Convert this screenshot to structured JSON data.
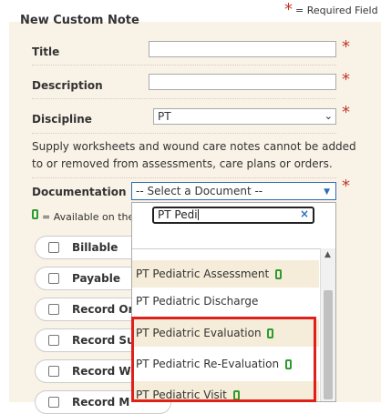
{
  "header": {
    "title": "New Custom Note",
    "required_star": "*",
    "required_label": "= Required Field"
  },
  "form": {
    "title_label": "Title",
    "title_value": "",
    "description_label": "Description",
    "description_value": "",
    "discipline_label": "Discipline",
    "discipline_value": "PT",
    "note": "Supply worksheets and wound care notes cannot be added to or removed from assessments, care plans or orders.",
    "note_line1": "Supply worksheets and wound care notes cannot be added",
    "note_line2": "to or removed from assessments, care plans or orders.",
    "documentation_label": "Documentation",
    "documentation_value": "-- Select a Document --",
    "available_legend": "= Available on the",
    "required_star": "*"
  },
  "checkboxes": [
    {
      "label": "Billable",
      "checked": false
    },
    {
      "label": "Payable",
      "checked": false
    },
    {
      "label": "Record Ord",
      "checked": false
    },
    {
      "label": "Record Sup",
      "checked": false
    },
    {
      "label": "Record Wo",
      "checked": false
    },
    {
      "label": "Record M",
      "checked": false
    }
  ],
  "dropdown": {
    "search_value": "PT Pedi",
    "clear_icon": "×",
    "options": [
      {
        "label": "PT Pediatric Assessment",
        "mobile": true,
        "highlighted": true
      },
      {
        "label": "PT Pediatric Discharge",
        "mobile": false,
        "highlighted": false
      },
      {
        "label": "PT Pediatric Evaluation",
        "mobile": true,
        "highlighted": true
      },
      {
        "label": "PT Pediatric Re-Evaluation",
        "mobile": true,
        "highlighted": false
      },
      {
        "label": "PT Pediatric Visit",
        "mobile": true,
        "highlighted": true
      }
    ]
  },
  "colors": {
    "panel_bg": "#f9f2e7",
    "required_red": "#c0392b",
    "mobile_green": "#2e9b2e",
    "focus_blue": "#2c6fbb",
    "callout_red": "#e0201b"
  },
  "icons": {
    "mobile": "mobile-device-icon",
    "select_arrow": "chevron-down-icon",
    "clear": "clear-icon"
  }
}
